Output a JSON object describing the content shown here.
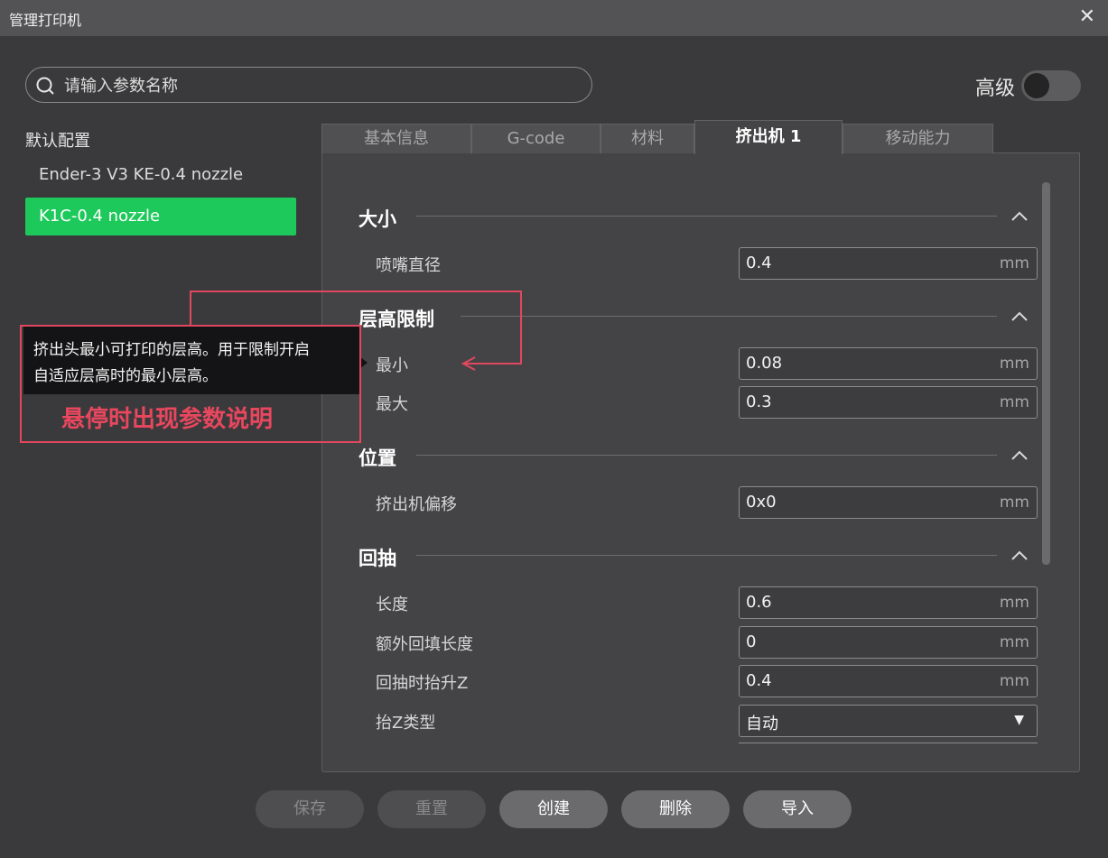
{
  "window": {
    "title": "管理打印机",
    "close_icon": "✕"
  },
  "search": {
    "placeholder": "请输入参数名称"
  },
  "advanced": {
    "label": "高级",
    "enabled": false
  },
  "sidebar": {
    "section_label": "默认配置",
    "presets": [
      {
        "label": "Ender-3 V3 KE-0.4 nozzle",
        "active": false
      },
      {
        "label": "K1C-0.4 nozzle",
        "active": true
      }
    ]
  },
  "tabs": [
    {
      "label": "基本信息",
      "active": false
    },
    {
      "label": "G-code",
      "active": false
    },
    {
      "label": "材料",
      "active": false
    },
    {
      "label": "挤出机 1",
      "active": true
    },
    {
      "label": "移动能力",
      "active": false
    }
  ],
  "groups": {
    "size": {
      "title": "大小",
      "params": [
        {
          "label": "喷嘴直径",
          "value": "0.4",
          "unit": "mm"
        }
      ]
    },
    "layer_height": {
      "title": "层高限制",
      "params": [
        {
          "label": "最小",
          "value": "0.08",
          "unit": "mm"
        },
        {
          "label": "最大",
          "value": "0.3",
          "unit": "mm"
        }
      ]
    },
    "position": {
      "title": "位置",
      "params": [
        {
          "label": "挤出机偏移",
          "value": "0x0",
          "unit": "mm"
        }
      ]
    },
    "retraction": {
      "title": "回抽",
      "params": [
        {
          "label": "长度",
          "value": "0.6",
          "unit": "mm"
        },
        {
          "label": "额外回填长度",
          "value": "0",
          "unit": "mm"
        },
        {
          "label": "回抽时抬升Z",
          "value": "0.4",
          "unit": "mm"
        },
        {
          "label": "抬Z类型",
          "value": "自动"
        }
      ]
    }
  },
  "tooltip": {
    "line1": "挤出头最小可打印的层高。用于限制开启",
    "line2": "自适应层高时的最小层高。"
  },
  "annotation": {
    "text": "悬停时出现参数说明",
    "color": "#e8475e"
  },
  "footer": {
    "save": "保存",
    "reset": "重置",
    "create": "创建",
    "delete": "删除",
    "import": "导入"
  },
  "colors": {
    "accent_green": "#1ec95b",
    "annotation_red": "#e0485f"
  }
}
